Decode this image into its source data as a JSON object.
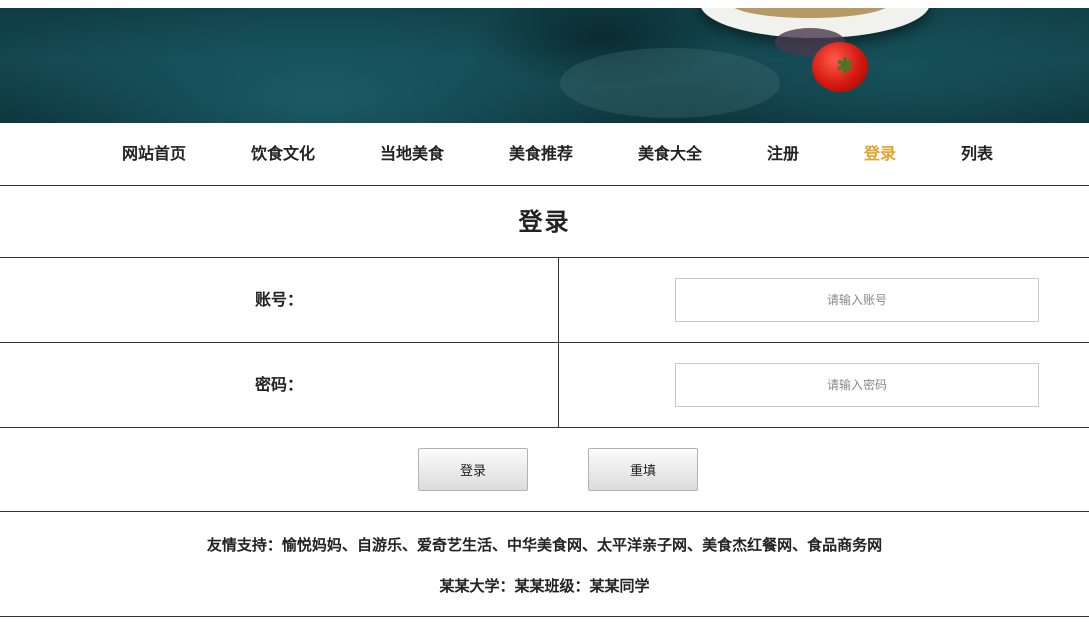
{
  "nav": {
    "items": [
      {
        "label": "网站首页",
        "active": false
      },
      {
        "label": "饮食文化",
        "active": false
      },
      {
        "label": "当地美食",
        "active": false
      },
      {
        "label": "美食推荐",
        "active": false
      },
      {
        "label": "美食大全",
        "active": false
      },
      {
        "label": "注册",
        "active": false
      },
      {
        "label": "登录",
        "active": true
      },
      {
        "label": "列表",
        "active": false
      }
    ],
    "active_color": "#e3a12e"
  },
  "page_title": "登录",
  "form": {
    "account_label": "账号：",
    "account_placeholder": "请输入账号",
    "account_value": "",
    "password_label": "密码：",
    "password_placeholder": "请输入密码",
    "password_value": ""
  },
  "actions": {
    "submit_label": "登录",
    "reset_label": "重填"
  },
  "footer": {
    "links_prefix": "友情支持：",
    "partners": [
      "愉悦妈妈",
      "自游乐",
      "爱奇艺生活",
      "中华美食网",
      "太平洋亲子网",
      "美食杰红餐网",
      "食品商务网"
    ],
    "separator": "、",
    "credit_school": "某某大学",
    "credit_sep1": "：",
    "credit_class": "某某班级",
    "credit_sep2": "：",
    "credit_student": "某某同学"
  },
  "banner": {
    "icons": [
      "plate-icon",
      "tomato-icon"
    ]
  }
}
